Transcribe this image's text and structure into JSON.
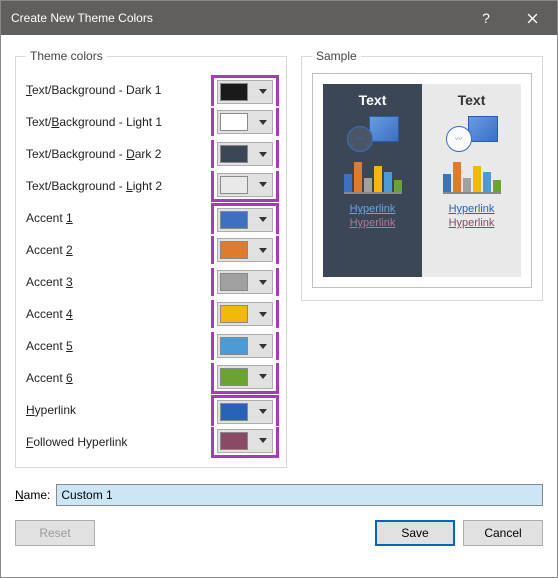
{
  "title": "Create New Theme Colors",
  "groups": {
    "theme": "Theme colors",
    "sample": "Sample"
  },
  "rows": [
    {
      "pre": "",
      "u": "T",
      "post": "ext/Background - Dark 1",
      "color": "#1a1a1a"
    },
    {
      "pre": "Text/",
      "u": "B",
      "post": "ackground - Light 1",
      "color": "#ffffff"
    },
    {
      "pre": "Text/Background - ",
      "u": "D",
      "post": "ark 2",
      "color": "#3b4657"
    },
    {
      "pre": "Text/Background - ",
      "u": "L",
      "post": "ight 2",
      "color": "#e9e9e9"
    },
    {
      "pre": "Accent ",
      "u": "1",
      "post": "",
      "color": "#3f6fc0"
    },
    {
      "pre": "Accent ",
      "u": "2",
      "post": "",
      "color": "#e07a2e"
    },
    {
      "pre": "Accent ",
      "u": "3",
      "post": "",
      "color": "#a0a0a0"
    },
    {
      "pre": "Accent ",
      "u": "4",
      "post": "",
      "color": "#f2b80c"
    },
    {
      "pre": "Accent ",
      "u": "5",
      "post": "",
      "color": "#4b9bd6"
    },
    {
      "pre": "Accent ",
      "u": "6",
      "post": "",
      "color": "#6aa332"
    },
    {
      "pre": "",
      "u": "H",
      "post": "yperlink",
      "color": "#2862b6"
    },
    {
      "pre": "",
      "u": "F",
      "post": "ollowed Hyperlink",
      "color": "#8a4a66"
    }
  ],
  "sample": {
    "text": "Text",
    "hyperlink": "Hyperlink",
    "hyperlink2": "Hyperlink",
    "dark_link": "#6aa3e8",
    "dark_followed": "#b07a96",
    "light_link": "#2862b6",
    "light_followed": "#8a4a66"
  },
  "name": {
    "label_pre": "",
    "label_u": "N",
    "label_post": "ame:",
    "value": "Custom 1"
  },
  "buttons": {
    "reset": "Reset",
    "save": "Save",
    "cancel": "Cancel"
  }
}
